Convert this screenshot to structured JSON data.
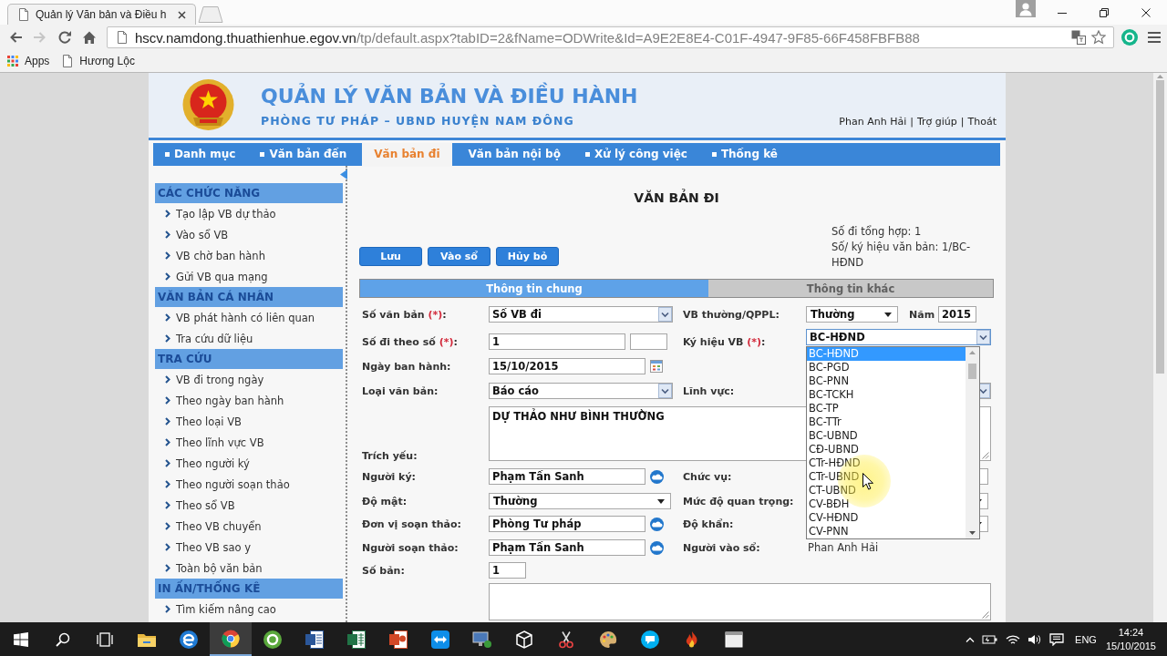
{
  "browser": {
    "tab_title": "Quản lý Văn bản và Điều h",
    "toolbar": [
      {
        "kind": "back",
        "disabled": false
      },
      {
        "kind": "forward",
        "disabled": true
      },
      {
        "kind": "reload",
        "disabled": false
      },
      {
        "kind": "home",
        "disabled": false
      }
    ],
    "url": {
      "host": "hscv.namdong.thuathienhue.egov.vn",
      "path": "/tp/default.aspx?tabID=2&fName=ODWrite&Id=A9E2E8E4-C01F-4947-9F85-66F458FBFB88"
    },
    "bookmarks": [
      {
        "kind": "apps",
        "label": "Apps"
      },
      {
        "kind": "page",
        "label": "Hương Lộc"
      }
    ]
  },
  "header": {
    "title": "QUẢN LÝ VĂN BẢN VÀ ĐIỀU HÀNH",
    "subtitle": "PHÒNG TƯ PHÁP – UBND HUYỆN NAM ĐÔNG",
    "user_links": [
      {
        "kind": "link",
        "label": "Phan Anh Hải"
      },
      {
        "kind": "separator",
        "label": "|"
      },
      {
        "kind": "link",
        "label": "Trợ giúp"
      },
      {
        "kind": "separator",
        "label": "|"
      },
      {
        "kind": "link",
        "label": "Thoát"
      }
    ]
  },
  "nav": [
    {
      "label": "Danh mục",
      "selected": false
    },
    {
      "label": "Văn bản đến",
      "selected": false
    },
    {
      "label": "Văn bản đi",
      "selected": true
    },
    {
      "label": "Văn bản nội bộ",
      "selected": false
    },
    {
      "label": "Xử lý công việc",
      "selected": false
    },
    {
      "label": "Thống kê",
      "selected": false
    }
  ],
  "sidebar": [
    {
      "title": "CÁC CHỨC NĂNG",
      "items": [
        "Tạo lập VB dự thảo",
        "Vào sổ VB",
        "VB chờ ban hành",
        "Gửi VB qua mạng"
      ]
    },
    {
      "title": "VĂN BẢN CÁ NHÂN",
      "items": [
        "VB phát hành có liên quan",
        "Tra cứu dữ liệu"
      ]
    },
    {
      "title": "TRA CỨU",
      "items": [
        "VB đi trong ngày",
        "Theo ngày ban hành",
        "Theo loại VB",
        "Theo lĩnh vực VB",
        "Theo người ký",
        "Theo người soạn thảo",
        "Theo sổ VB",
        "Theo VB chuyển",
        "Theo VB sao y",
        "Toàn bộ văn bản"
      ]
    },
    {
      "title": "IN ẤN/THỐNG KÊ",
      "items": [
        "Tìm kiếm nâng cao"
      ]
    }
  ],
  "main": {
    "title": "VĂN BẢN ĐI",
    "summary": [
      "Số đi tổng hợp: 1",
      "Số/ ký hiệu văn bản: 1/BC-HĐND"
    ],
    "buttons": [
      "Lưu",
      "Vào sổ",
      "Hủy bỏ"
    ],
    "tabs": [
      {
        "label": "Thông tin chung",
        "selected": true
      },
      {
        "label": "Thông tin khác",
        "selected": false
      }
    ],
    "form": {
      "rows": [
        {
          "left": {
            "kind": "select",
            "label": "Số văn bản",
            "required": "(*)",
            "label_end": ":",
            "value": "Số VB đi",
            "expanded": false
          },
          "right": {
            "kind": "select_year",
            "label": "VB thường/QPPL:",
            "value": "Thường",
            "expanded": false,
            "year_label": "Năm",
            "year": "2015"
          }
        },
        {
          "left": {
            "kind": "pair",
            "label": "Số đi theo số",
            "required": "(*)",
            "label_end": ":",
            "value": "1"
          },
          "right": {
            "kind": "select",
            "label": "Ký hiệu VB",
            "required": "(*)",
            "label_end": ":",
            "value": "BC-HĐND",
            "expanded": true,
            "options": [
              {
                "label": "BC-HĐND",
                "selected": true
              },
              {
                "label": "BC-PGD",
                "selected": false
              },
              {
                "label": "BC-PNN",
                "selected": false
              },
              {
                "label": "BC-TCKH",
                "selected": false
              },
              {
                "label": "BC-TP",
                "selected": false
              },
              {
                "label": "BC-TTr",
                "selected": false
              },
              {
                "label": "BC-UBND",
                "selected": false
              },
              {
                "label": "CĐ-UBND",
                "selected": false
              },
              {
                "label": "CTr-HĐND",
                "selected": false
              },
              {
                "label": "CTr-UBND",
                "selected": false
              },
              {
                "label": "CT-UBND",
                "selected": false
              },
              {
                "label": "CV-BĐH",
                "selected": false
              },
              {
                "label": "CV-HĐND",
                "selected": false
              },
              {
                "label": "CV-PNN",
                "selected": false
              }
            ]
          }
        },
        {
          "left": {
            "kind": "date",
            "label": "Ngày ban hành:",
            "value": "15/10/2015"
          }
        },
        {
          "left": {
            "kind": "select",
            "label": "Loại văn bản:",
            "value": "Báo cáo",
            "expanded": false
          },
          "right": {
            "kind": "select",
            "label": "Lĩnh vực:",
            "expanded": false
          }
        },
        {
          "wide": {
            "kind": "textarea",
            "label": "Trích yếu:",
            "value": "DỰ THẢO NHƯ BÌNH THƯỜNG"
          }
        },
        {
          "left": {
            "kind": "lookup",
            "label": "Người ký:",
            "value": "Phạm Tấn Sanh"
          },
          "right": {
            "kind": "input",
            "label": "Chức vụ:"
          }
        },
        {
          "left": {
            "kind": "select_flat",
            "label": "Độ mật:",
            "value": "Thường",
            "expanded": false
          },
          "right": {
            "kind": "select_flat",
            "label": "Mức độ quan trọng:",
            "expanded": false
          }
        },
        {
          "left": {
            "kind": "lookup",
            "label": "Đơn vị soạn thảo:",
            "value": "Phòng Tư pháp"
          },
          "right": {
            "kind": "select_flat",
            "label": "Độ khẩn:",
            "expanded": false
          }
        },
        {
          "left": {
            "kind": "lookup",
            "label": "Người soạn thảo:",
            "value": "Phạm Tấn Sanh"
          },
          "right": {
            "kind": "text",
            "label": "Người vào sổ:",
            "value": "Phan Anh Hải"
          }
        },
        {
          "left": {
            "kind": "number",
            "label": "Số bản:",
            "value": "1"
          }
        },
        {
          "wide": {
            "kind": "textarea"
          }
        }
      ]
    }
  },
  "taskbar": {
    "buttons": [
      {
        "kind": "start",
        "active": false
      },
      {
        "kind": "search",
        "active": false
      },
      {
        "kind": "task_view",
        "active": false
      },
      {
        "kind": "folder",
        "active": false
      },
      {
        "kind": "swirl_browser",
        "active": false
      },
      {
        "kind": "round_browser",
        "active": true
      },
      {
        "kind": "ring_app",
        "active": false
      },
      {
        "kind": "document",
        "active": false
      },
      {
        "kind": "spreadsheet",
        "active": false
      },
      {
        "kind": "presentation",
        "active": false
      },
      {
        "kind": "double_arrow",
        "active": false
      },
      {
        "kind": "monitor",
        "active": false
      },
      {
        "kind": "cube",
        "active": false
      },
      {
        "kind": "scissors",
        "active": false
      },
      {
        "kind": "palette",
        "active": false
      },
      {
        "kind": "chat",
        "active": false
      },
      {
        "kind": "flame",
        "active": false
      },
      {
        "kind": "window",
        "active": false
      }
    ],
    "language": "ENG",
    "time": "14:24",
    "date": "15/10/2015"
  }
}
